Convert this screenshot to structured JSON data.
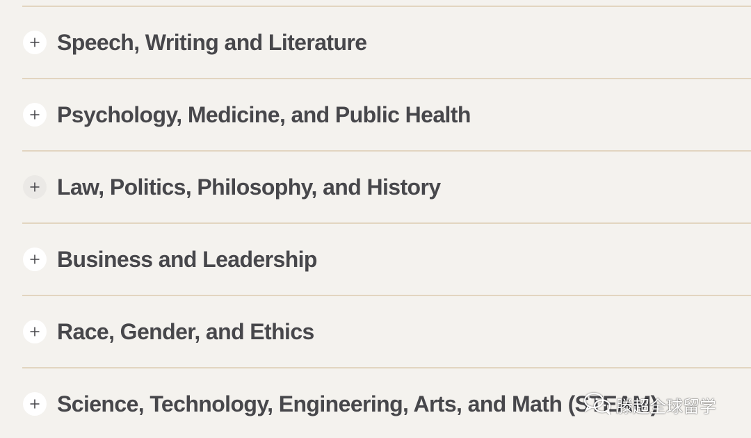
{
  "accordion": {
    "items": [
      {
        "label": "Speech, Writing and Literature",
        "icon": "plus-icon"
      },
      {
        "label": "Psychology, Medicine, and Public Health",
        "icon": "plus-icon"
      },
      {
        "label": "Law, Politics, Philosophy, and History",
        "icon": "plus-icon"
      },
      {
        "label": "Business and Leadership",
        "icon": "plus-icon"
      },
      {
        "label": "Race, Gender, and Ethics",
        "icon": "plus-icon"
      },
      {
        "label": "Science, Technology, Engineering, Arts, and Math (STEAM)",
        "icon": "plus-icon"
      }
    ]
  },
  "watermark": {
    "text": "滕超全球留学",
    "icon": "wechat-icon"
  },
  "colors": {
    "background": "#f4f2ee",
    "divider": "#e2d5c0",
    "text": "#47474b",
    "toggle_bg": "#ffffff"
  }
}
